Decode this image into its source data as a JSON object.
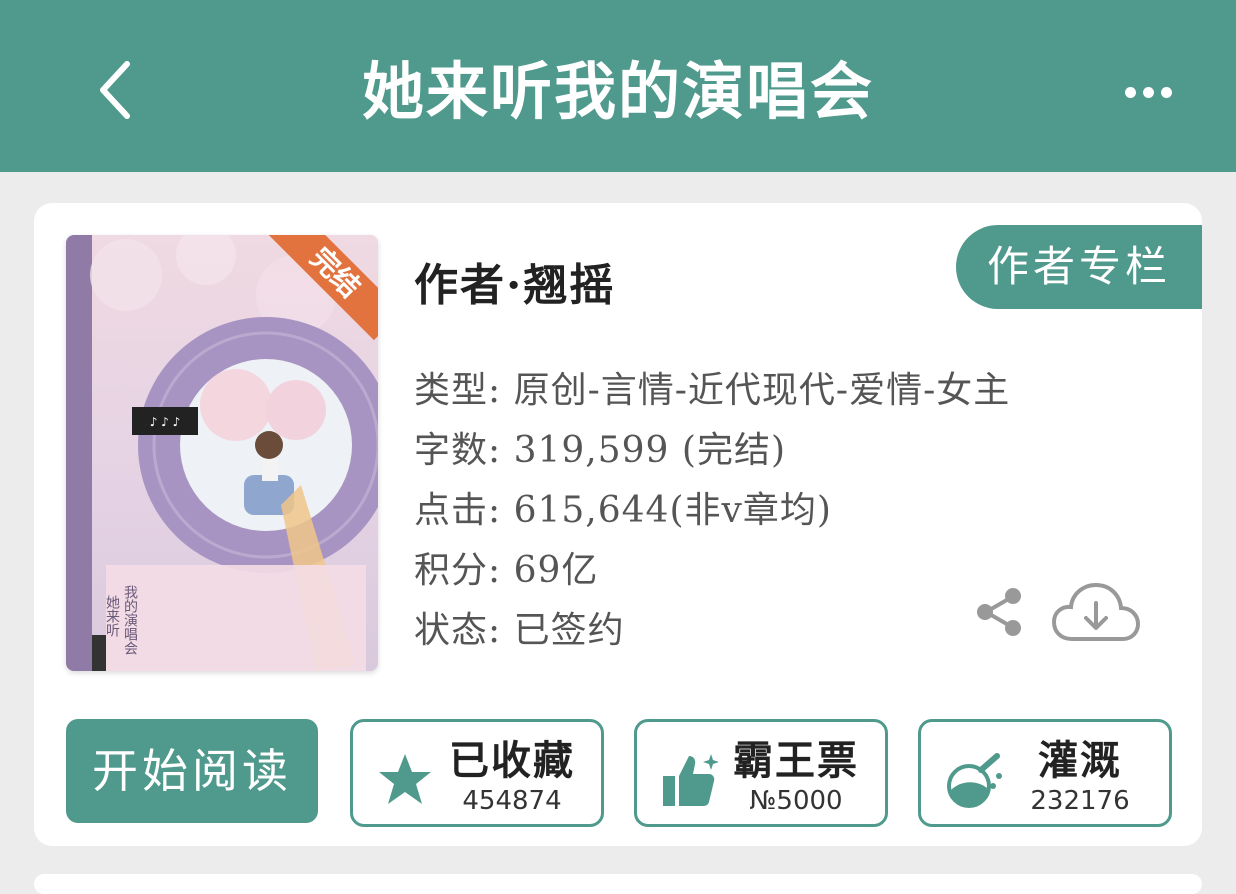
{
  "header": {
    "title": "她来听我的演唱会",
    "back_icon": "chevron-left-icon",
    "more_icon": "more-horizontal-icon"
  },
  "book": {
    "status_ribbon": "完结",
    "cover_title": "她来听我的演唱会",
    "author": "作者·翘摇",
    "author_column_label": "作者专栏",
    "info": [
      {
        "label": "类型:",
        "value": "原创-言情-近代现代-爱情-女主"
      },
      {
        "label": "字数:",
        "value": "319,599 (完结)"
      },
      {
        "label": "点击:",
        "value": "615,644(非v章均)"
      },
      {
        "label": "积分:",
        "value": "69亿"
      },
      {
        "label": "状态:",
        "value": "已签约"
      }
    ]
  },
  "actions": {
    "start_reading": "开始阅读",
    "collect": {
      "label": "已收藏",
      "count": "454874",
      "icon": "star-icon"
    },
    "vote": {
      "label": "霸王票",
      "count": "№5000",
      "icon": "thumbs-up-icon"
    },
    "nourish": {
      "label": "灌溉",
      "count": "232176",
      "icon": "flask-icon"
    }
  },
  "colors": {
    "primary": "#4f9a8c",
    "ribbon": "#e2733f",
    "background": "#ececec"
  }
}
